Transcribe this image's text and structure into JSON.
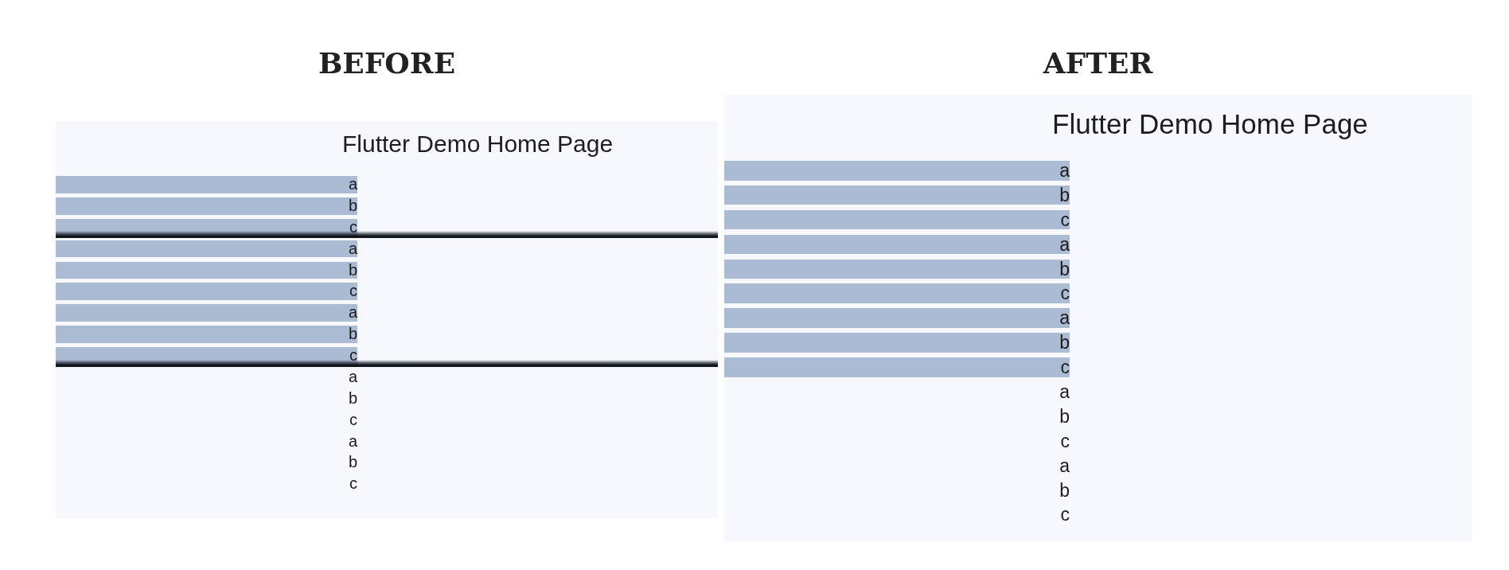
{
  "panels": [
    {
      "heading": "BEFORE",
      "app_title": "Flutter Demo Home Page",
      "items": [
        {
          "label": "a",
          "filled": true,
          "shadow": false
        },
        {
          "label": "b",
          "filled": true,
          "shadow": false
        },
        {
          "label": "c",
          "filled": true,
          "shadow": true
        },
        {
          "label": "a",
          "filled": true,
          "shadow": false
        },
        {
          "label": "b",
          "filled": true,
          "shadow": false
        },
        {
          "label": "c",
          "filled": true,
          "shadow": false
        },
        {
          "label": "a",
          "filled": true,
          "shadow": false
        },
        {
          "label": "b",
          "filled": true,
          "shadow": false
        },
        {
          "label": "c",
          "filled": true,
          "shadow": true
        },
        {
          "label": "a",
          "filled": false,
          "shadow": false
        },
        {
          "label": "b",
          "filled": false,
          "shadow": false
        },
        {
          "label": "c",
          "filled": false,
          "shadow": false
        },
        {
          "label": "a",
          "filled": false,
          "shadow": false
        },
        {
          "label": "b",
          "filled": false,
          "shadow": false
        },
        {
          "label": "c",
          "filled": false,
          "shadow": false
        }
      ]
    },
    {
      "heading": "AFTER",
      "app_title": "Flutter Demo Home Page",
      "items": [
        {
          "label": "a",
          "filled": true,
          "shadow": false
        },
        {
          "label": "b",
          "filled": true,
          "shadow": false
        },
        {
          "label": "c",
          "filled": true,
          "shadow": false
        },
        {
          "label": "a",
          "filled": true,
          "shadow": false
        },
        {
          "label": "b",
          "filled": true,
          "shadow": false
        },
        {
          "label": "c",
          "filled": true,
          "shadow": false
        },
        {
          "label": "a",
          "filled": true,
          "shadow": false
        },
        {
          "label": "b",
          "filled": true,
          "shadow": false
        },
        {
          "label": "c",
          "filled": true,
          "shadow": false
        },
        {
          "label": "a",
          "filled": false,
          "shadow": false
        },
        {
          "label": "b",
          "filled": false,
          "shadow": false
        },
        {
          "label": "c",
          "filled": false,
          "shadow": false
        },
        {
          "label": "a",
          "filled": false,
          "shadow": false
        },
        {
          "label": "b",
          "filled": false,
          "shadow": false
        },
        {
          "label": "c",
          "filled": false,
          "shadow": false
        }
      ]
    }
  ]
}
